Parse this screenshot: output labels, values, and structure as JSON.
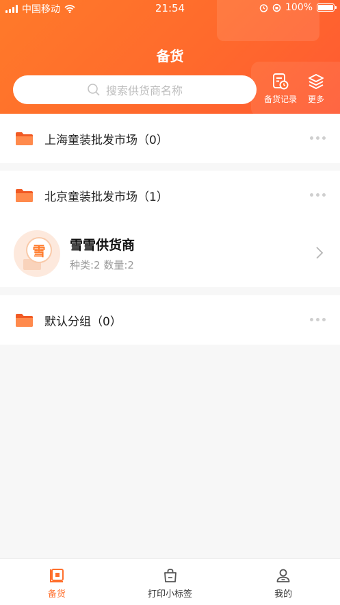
{
  "status_bar": {
    "carrier": "中国移动",
    "time": "21:54",
    "battery": "100%"
  },
  "header": {
    "title": "备货"
  },
  "search": {
    "placeholder": "搜索供货商名称"
  },
  "header_actions": [
    {
      "label": "备货记录",
      "icon": "record-icon"
    },
    {
      "label": "更多",
      "icon": "layers-icon"
    }
  ],
  "groups": [
    {
      "name": "上海童装批发市场",
      "count": "（0）",
      "suppliers": []
    },
    {
      "name": "北京童装批发市场",
      "count": "（1）",
      "suppliers": [
        {
          "avatar_char": "雪",
          "name": "雪雪供货商",
          "meta": "种类:2 数量:2"
        }
      ]
    },
    {
      "name": "默认分组",
      "count": "（0）",
      "suppliers": []
    }
  ],
  "tabbar": [
    {
      "label": "备货",
      "icon": "stock-icon",
      "active": true
    },
    {
      "label": "打印小标签",
      "icon": "print-bag-icon",
      "active": false
    },
    {
      "label": "我的",
      "icon": "user-icon",
      "active": false
    }
  ],
  "colors": {
    "accent": "#ff6f2c",
    "header_start": "#ff7a2a",
    "header_end": "#ff5a32"
  }
}
